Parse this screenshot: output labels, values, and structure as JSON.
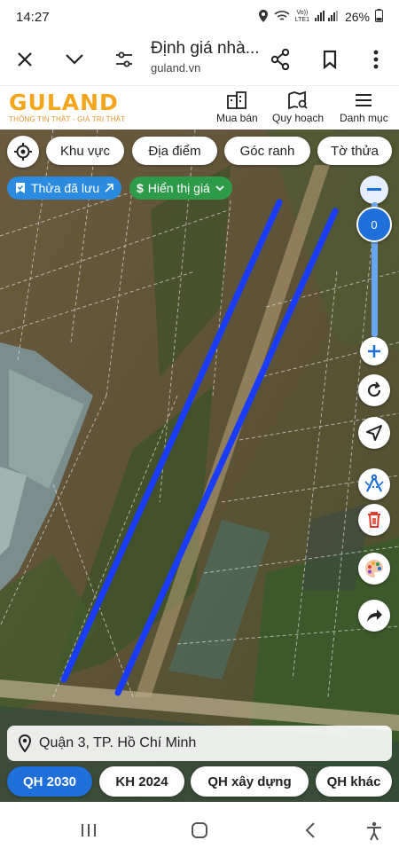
{
  "status": {
    "time": "14:27",
    "battery": "26%",
    "net_top": "Vo))",
    "net_bottom": "LTE1"
  },
  "browser": {
    "title": "Định giá nhà...",
    "domain": "guland.vn"
  },
  "app": {
    "brand": "GULAND",
    "tagline": "THÔNG TIN THẬT - GIÁ TRỊ THẬT",
    "nav": [
      "Mua bán",
      "Quy hoạch",
      "Danh mục"
    ]
  },
  "filters": [
    "Khu vực",
    "Địa điểm",
    "Góc ranh",
    "Tờ thửa"
  ],
  "saved_label": "Thửa đã lưu",
  "price_label": "Hiển thị giá",
  "zoom_value": "0",
  "location": "Quận 3, TP. Hồ Chí Minh",
  "plan_tabs": [
    "QH 2030",
    "KH 2024",
    "QH xây dựng",
    "QH khác"
  ],
  "colors": {
    "brand": "#f4a51c",
    "accent_blue": "#1e6fd9",
    "price_green": "#2e9b4b",
    "highlight_line": "#1a3cff"
  }
}
